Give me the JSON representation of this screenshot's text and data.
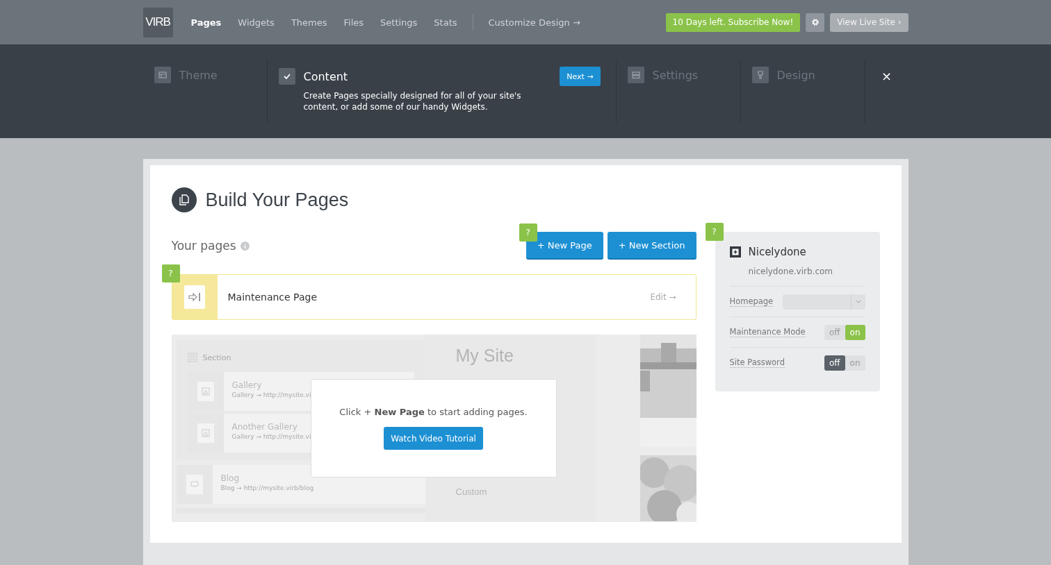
{
  "topbar": {
    "logo": "VIRB",
    "nav": [
      {
        "label": "Pages",
        "selected": true
      },
      {
        "label": "Widgets",
        "selected": false
      },
      {
        "label": "Themes",
        "selected": false
      },
      {
        "label": "Files",
        "selected": false
      },
      {
        "label": "Settings",
        "selected": false
      },
      {
        "label": "Stats",
        "selected": false
      }
    ],
    "customize": "Customize Design →",
    "subscribe": "10 Days left. Subscribe Now!",
    "live_site": "View Live Site ›"
  },
  "steps": {
    "items": [
      {
        "kind": "theme",
        "label": "Theme",
        "selected": false
      },
      {
        "kind": "content",
        "label": "Content",
        "selected": true,
        "description": "Create Pages specially designed for all of your site's content, or add some of our handy Widgets.",
        "next": "Next →"
      },
      {
        "kind": "settings",
        "label": "Settings",
        "selected": false
      },
      {
        "kind": "design",
        "label": "Design",
        "selected": false
      }
    ],
    "close": "×"
  },
  "main": {
    "title": "Build Your Pages",
    "subtitle": "Your pages",
    "help": [
      "?",
      "?",
      "?"
    ],
    "buttons": [
      "+  New Page",
      "+  New Section"
    ],
    "pages": [
      {
        "name": "Maintenance Page",
        "edit": "Edit →"
      }
    ],
    "preview": {
      "section": "Section",
      "items": [
        {
          "name": "Gallery",
          "url": "Gallery → http://mysite.vi"
        },
        {
          "name": "Another Gallery",
          "url": "Gallery → http://mysite.vi"
        }
      ],
      "blog": {
        "name": "Blog",
        "url": "Blog → http://mysite.virb/blog"
      },
      "site_title": "My Site",
      "menu_last": "Custom"
    },
    "empty": {
      "message": "Click + **New Page** to start adding pages.",
      "button": "Watch Video Tutorial"
    }
  },
  "site": {
    "name": "Nicelydone",
    "url": "nicelydone.virb.com",
    "settings": [
      {
        "kind": "select",
        "label": "Homepage"
      },
      {
        "kind": "toggle",
        "label": "Maintenance Mode",
        "off": "off",
        "on_label": "on",
        "on": true
      },
      {
        "kind": "toggle",
        "label": "Site Password",
        "off": "off",
        "on_label": "on",
        "on": false
      }
    ]
  }
}
